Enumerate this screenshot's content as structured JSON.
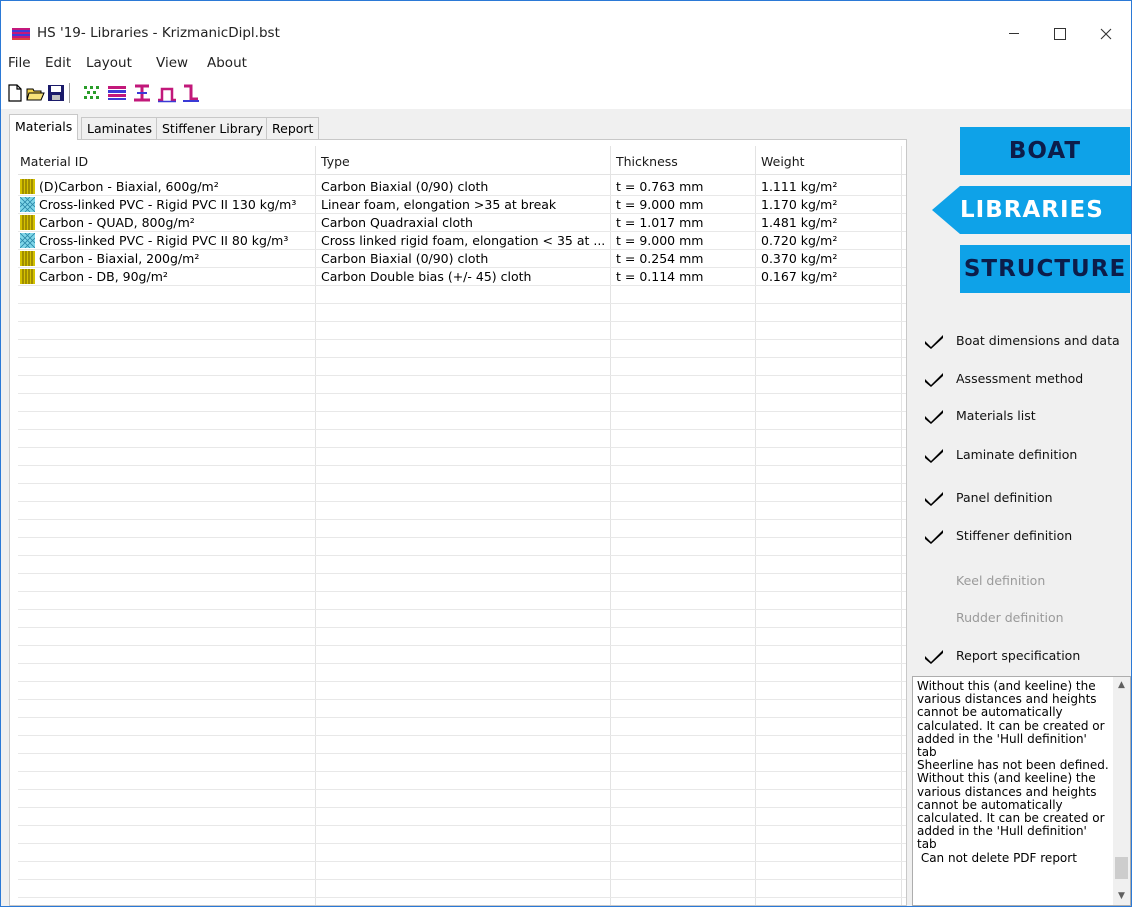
{
  "window": {
    "title": "HS '19- Libraries - KrizmanicDipl.bst",
    "minimize_label": "—",
    "maximize_label": "☐",
    "close_label": "✕"
  },
  "menu": [
    "File",
    "Edit",
    "Layout",
    "View",
    "About"
  ],
  "toolbar": {
    "buttons": [
      "new-file-icon",
      "open-folder-icon",
      "save-disk-icon",
      "materials-grid-icon",
      "laminate-icon",
      "stiffener-i-icon",
      "stiffener-top-hat-icon",
      "stiffener-angle-icon"
    ]
  },
  "tabs": [
    "Materials",
    "Laminates",
    "Stiffener Library",
    "Report"
  ],
  "active_tab": "Materials",
  "table": {
    "columns": [
      "Material ID",
      "Type",
      "Thickness",
      "Weight"
    ],
    "rows": [
      {
        "icon": "carbon-fabric-icon",
        "id": "(D)Carbon - Biaxial, 600g/m²",
        "type": "Carbon Biaxial (0/90) cloth",
        "thickness": "t = 0.763 mm",
        "weight": "1.111 kg/m²"
      },
      {
        "icon": "foam-core-icon",
        "id": "Cross-linked PVC - Rigid PVC II 130 kg/m³",
        "type": "Linear foam, elongation >35 at break",
        "thickness": "t = 9.000 mm",
        "weight": "1.170 kg/m²"
      },
      {
        "icon": "carbon-fabric-icon",
        "id": "Carbon - QUAD, 800g/m²",
        "type": "Carbon  Quadraxial cloth",
        "thickness": "t = 1.017 mm",
        "weight": "1.481 kg/m²"
      },
      {
        "icon": "foam-core-icon",
        "id": "Cross-linked PVC - Rigid PVC II 80 kg/m³",
        "type": "Cross linked rigid foam, elongation < 35 at ...",
        "thickness": "t = 9.000 mm",
        "weight": "0.720 kg/m²"
      },
      {
        "icon": "carbon-fabric-icon",
        "id": "Carbon - Biaxial, 200g/m²",
        "type": "Carbon Biaxial (0/90) cloth",
        "thickness": "t = 0.254 mm",
        "weight": "0.370 kg/m²"
      },
      {
        "icon": "carbon-fabric-icon",
        "id": "Carbon - DB, 90g/m²",
        "type": "Carbon Double bias (+/- 45) cloth",
        "thickness": "t = 0.114 mm",
        "weight": "0.167 kg/m²"
      }
    ]
  },
  "nav": {
    "boat": "BOAT",
    "libraries": "LIBRARIES",
    "structure": "STRUCTURE"
  },
  "checklist": [
    {
      "label": "Boat dimensions and data",
      "done": true
    },
    {
      "label": "Assessment method",
      "done": true
    },
    {
      "label": "Materials list",
      "done": true
    },
    {
      "label": "Laminate definition",
      "done": true
    },
    {
      "label": "Panel definition",
      "done": true
    },
    {
      "label": "Stiffener definition",
      "done": true
    },
    {
      "label": "Keel definition",
      "done": false
    },
    {
      "label": "Rudder definition",
      "done": false
    },
    {
      "label": "Report specification",
      "done": true
    }
  ],
  "messages": "Without this (and keeline) the various distances and heights cannot be automatically calculated. It can be created or added in the 'Hull definition' tab\nSheerline has not been defined. Without this (and keeline) the various distances and heights cannot be automatically calculated. It can be created or added in the 'Hull definition' tab\n Can not delete PDF report",
  "colors": {
    "nav_button": "#0ea2e8",
    "nav_text": "#0c1d4a",
    "window_border": "#2b79d6"
  }
}
